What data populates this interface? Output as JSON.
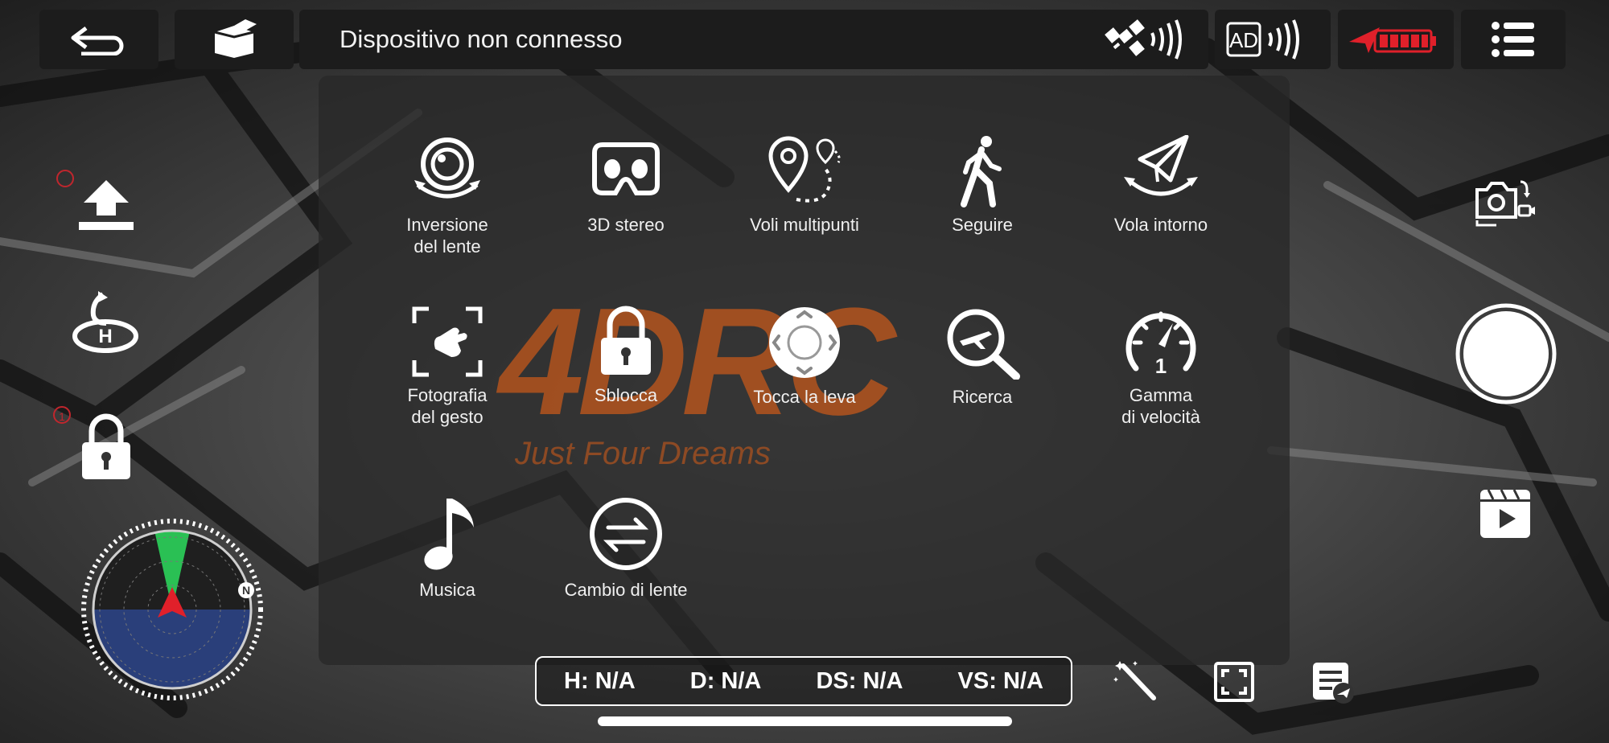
{
  "topbar": {
    "status": "Dispositivo non connesso",
    "gps_signal_icon": "satellite-signal-icon",
    "ad_signal_label": "AD",
    "battery_icon": "battery-icon"
  },
  "logo": {
    "brand": "4DRC",
    "tagline": "Just Four Dreams",
    "color": "#b3541e"
  },
  "menu": {
    "items": [
      {
        "label": "Inversione\ndel lente",
        "icon": "lens-flip-icon"
      },
      {
        "label": "3D stereo",
        "icon": "vr-goggles-icon"
      },
      {
        "label": "Voli multipunti",
        "icon": "waypoints-icon"
      },
      {
        "label": "Seguire",
        "icon": "walking-person-icon"
      },
      {
        "label": "Vola intorno",
        "icon": "orbit-plane-icon"
      },
      {
        "label": "Fotografia\ndel gesto",
        "icon": "gesture-photo-icon"
      },
      {
        "label": "Sblocca",
        "icon": "lock-icon"
      },
      {
        "label": "Tocca la leva",
        "icon": "joystick-icon"
      },
      {
        "label": "Ricerca",
        "icon": "search-plane-icon"
      },
      {
        "label": "Gamma\ndi velocità",
        "icon": "speedometer-icon"
      },
      {
        "label": "Musica",
        "icon": "music-note-icon"
      },
      {
        "label": "Cambio di lente",
        "icon": "switch-lens-icon"
      }
    ]
  },
  "left": {
    "takeoff_badge": "",
    "lock_badge": "1",
    "compass_north": "N"
  },
  "telemetry": {
    "h": "H: N/A",
    "d": "D: N/A",
    "ds": "DS: N/A",
    "vs": "VS: N/A"
  },
  "colors": {
    "accent_red": "#e0202a",
    "radar_green": "#2bd15a",
    "radar_blue": "#2a3f7a"
  }
}
